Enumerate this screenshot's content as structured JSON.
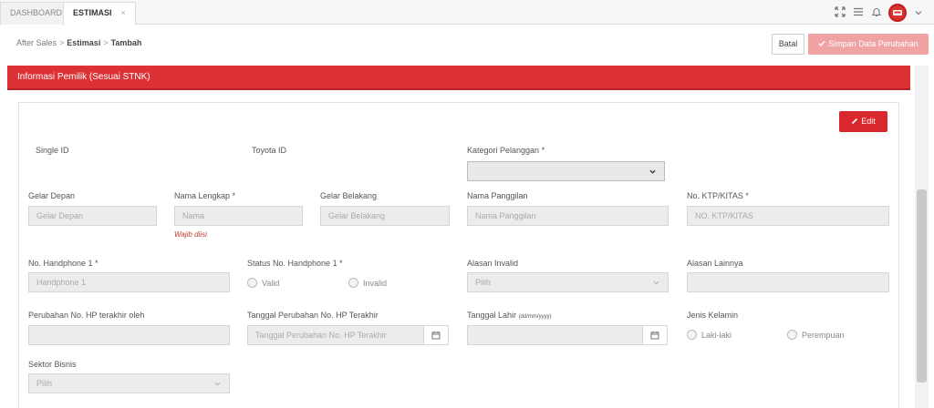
{
  "tabs": [
    {
      "label": "DASHBOARD"
    },
    {
      "label": "ESTIMASI",
      "close": "×"
    }
  ],
  "icons": [
    "expand-icon",
    "menu-icon",
    "bell-icon",
    "avatar-icon",
    "chevron-down-icon"
  ],
  "breadcrumb": {
    "items": [
      "After Sales",
      "Estimasi",
      "Tambah"
    ],
    "separator": ">"
  },
  "actions": {
    "cancel": "Batal",
    "save": "Simpan Data Perubahan"
  },
  "section": {
    "title": "Informasi Pemilik (Sesuai STNK)",
    "edit": "Edit"
  },
  "fields": {
    "single_id": {
      "label": "Single ID"
    },
    "toyota_id": {
      "label": "Toyota ID"
    },
    "kategori": {
      "label": "Kategori Pelanggan *",
      "value": ""
    },
    "gelar_depan": {
      "label": "Gelar Depan",
      "placeholder": "Gelar Depan"
    },
    "nama_lengkap": {
      "label": "Nama Lengkap *",
      "placeholder": "Nama",
      "hint": "Wajib diisi"
    },
    "gelar_belakang": {
      "label": "Gelar Belakang",
      "placeholder": "Gelar Belakang"
    },
    "nama_panggilan": {
      "label": "Nama Panggilan",
      "placeholder": "Nama Panggilan"
    },
    "ktp": {
      "label": "No. KTP/KITAS *",
      "placeholder": "NO. KTP/KITAS"
    },
    "hp1": {
      "label": "No. Handphone 1 *",
      "placeholder": "Handphone 1"
    },
    "status_hp": {
      "label": "Status No. Handphone 1 *",
      "options": [
        "Valid",
        "Invalid"
      ]
    },
    "alasan_invalid": {
      "label": "Alasan Invalid",
      "value": "Pilih"
    },
    "alasan_lainnya": {
      "label": "Alasan Lainnya",
      "placeholder": ""
    },
    "perubahan_hp_oleh": {
      "label": "Perubahan No. HP terakhir oleh",
      "placeholder": ""
    },
    "tgl_perubahan_hp": {
      "label": "Tanggal Perubahan No. HP Terakhir",
      "placeholder": "Tanggal Perubahan No. HP Terakhir"
    },
    "tgl_lahir": {
      "label": "Tanggal Lahir",
      "format": "(dd/mm/yyyy)",
      "placeholder": ""
    },
    "jenis_kelamin": {
      "label": "Jenis Kelamin",
      "options": [
        "Laki-laki",
        "Perempuan"
      ]
    },
    "sektor_bisnis": {
      "label": "Sektor Bisnis",
      "value": "Pilih"
    }
  },
  "colors": {
    "primary": "#dc3135",
    "save_disabled": "#f0a3a3"
  }
}
